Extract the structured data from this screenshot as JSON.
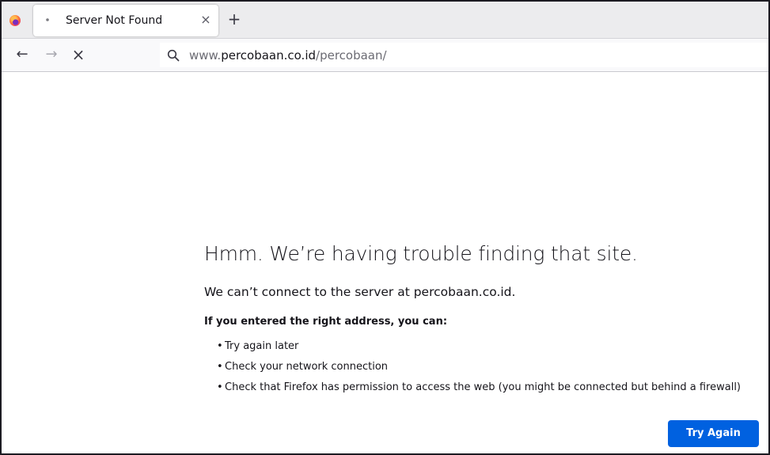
{
  "browser": {
    "tab": {
      "title": "Server Not Found",
      "close_glyph": "×"
    },
    "new_tab_glyph": "+",
    "nav": {
      "back_glyph": "←",
      "forward_glyph": "→",
      "stop_glyph": "×"
    },
    "url": {
      "prefix": "www.",
      "host": "percobaan.co.id",
      "path": "/percobaan/"
    }
  },
  "error_page": {
    "title": "Hmm. We’re having trouble finding that site.",
    "description": "We can’t connect to the server at percobaan.co.id.",
    "suggestions_heading": "If you entered the right address, you can:",
    "suggestions": [
      "Try again later",
      "Check your network connection",
      "Check that Firefox has permission to access the web (you might be connected but behind a firewall)"
    ],
    "try_again_label": "Try Again"
  },
  "colors": {
    "accent": "#0061e0",
    "tabstrip": "#ececee",
    "navbar": "#f9f9fb"
  },
  "icons": [
    "firefox-logo-icon",
    "tab-loading-dot-icon",
    "close-icon",
    "plus-icon",
    "back-arrow-icon",
    "forward-arrow-icon",
    "stop-icon",
    "search-icon"
  ]
}
